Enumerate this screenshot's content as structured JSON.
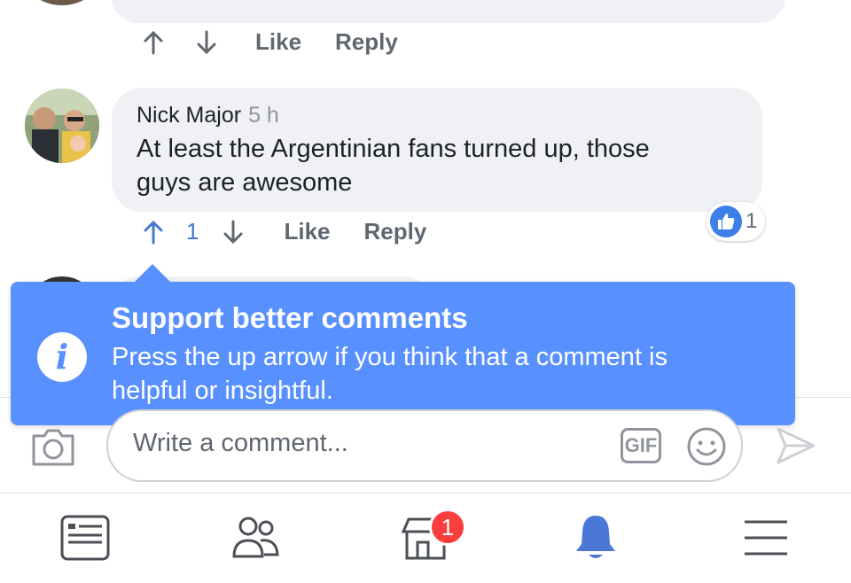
{
  "previous_comment": {
    "actions": {
      "like": "Like",
      "reply": "Reply"
    }
  },
  "comment": {
    "author": "Nick Major",
    "time": "5 h",
    "text_line1": "At least the Argentinian fans turned up, those",
    "text_line2": "guys are awesome",
    "upvotes": "1",
    "actions": {
      "like": "Like",
      "reply": "Reply"
    },
    "reaction_count": "1"
  },
  "tooltip": {
    "title": "Support better comments",
    "body_line1": "Press the up arrow if you think that a comment is",
    "body_line2": "helpful or insightful.",
    "icon": "info-icon"
  },
  "composer": {
    "placeholder": "Write a comment...",
    "gif_label": "GIF"
  },
  "bottom_nav": {
    "items": [
      "news-feed-icon",
      "friends-icon",
      "marketplace-icon",
      "notifications-bell-icon",
      "menu-icon"
    ],
    "marketplace_badge": "1",
    "active": "notifications-bell-icon"
  },
  "colors": {
    "accent": "#4b77d6",
    "tooltip_bg": "#5890ff",
    "badge": "#fa3e3e",
    "bubble_bg": "#f0f1f4"
  }
}
